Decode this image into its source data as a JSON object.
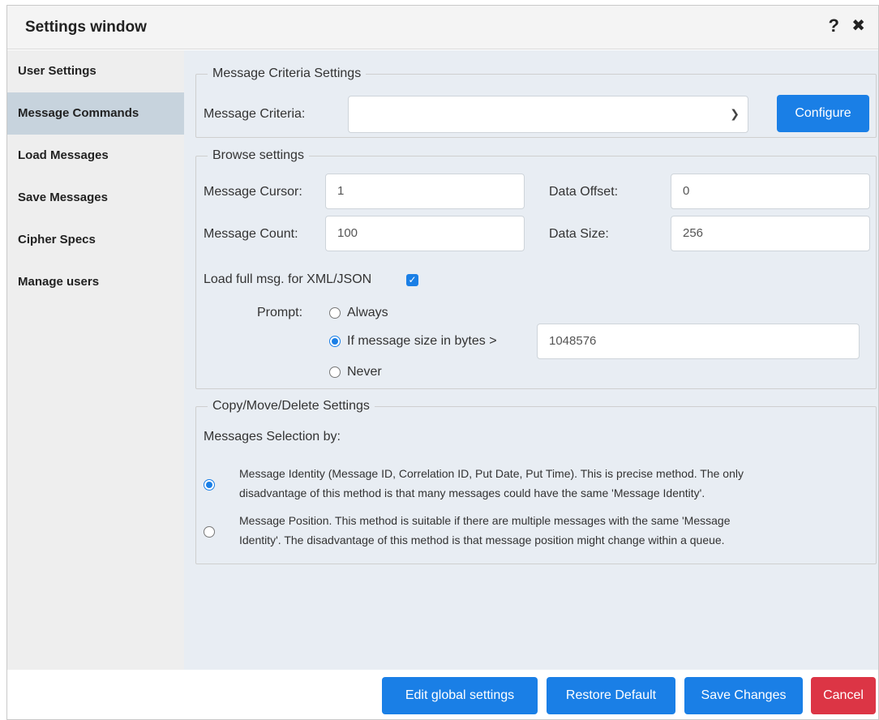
{
  "window": {
    "title": "Settings window",
    "help_glyph": "?",
    "close_glyph": "✖"
  },
  "sidebar": {
    "items": [
      {
        "label": "User Settings"
      },
      {
        "label": "Message Commands"
      },
      {
        "label": "Load Messages"
      },
      {
        "label": "Save Messages"
      },
      {
        "label": "Cipher Specs"
      },
      {
        "label": "Manage users"
      }
    ],
    "active_index": 1
  },
  "criteria": {
    "legend": "Message Criteria Settings",
    "label": "Message Criteria:",
    "value": "",
    "configure_label": "Configure"
  },
  "browse": {
    "legend": "Browse settings",
    "cursor_label": "Message Cursor:",
    "cursor_value": "1",
    "count_label": "Message Count:",
    "count_value": "100",
    "offset_label": "Data Offset:",
    "offset_value": "0",
    "size_label": "Data Size:",
    "size_value": "256",
    "load_full_label": "Load full msg. for XML/JSON",
    "load_full_checked": true,
    "prompt_label": "Prompt:",
    "prompt_options": [
      {
        "label": "Always",
        "selected": false
      },
      {
        "label": "If message size in bytes >",
        "selected": true
      },
      {
        "label": "Never",
        "selected": false
      }
    ],
    "threshold_value": "1048576"
  },
  "cmd": {
    "legend": "Copy/Move/Delete Settings",
    "selection_label": "Messages Selection by:",
    "options": [
      {
        "line1": "Message Identity (Message ID, Correlation ID, Put Date, Put Time). This is precise method. The only",
        "line2": "disadvantage of this method is that many messages could have the same 'Message Identity'.",
        "selected": true
      },
      {
        "line1": "Message Position. This method is suitable if there are multiple messages with the same 'Message",
        "line2": "Identity'. The disadvantage of this method is that message position might change within a queue.",
        "selected": false
      }
    ]
  },
  "footer": {
    "edit_global_label": "Edit global settings",
    "restore_label": "Restore Default",
    "save_label": "Save Changes",
    "cancel_label": "Cancel"
  },
  "colors": {
    "primary": "#1a7fe6",
    "danger": "#dc3545",
    "active_nav": "#c7d3dd",
    "content_bg": "#e8edf3"
  }
}
